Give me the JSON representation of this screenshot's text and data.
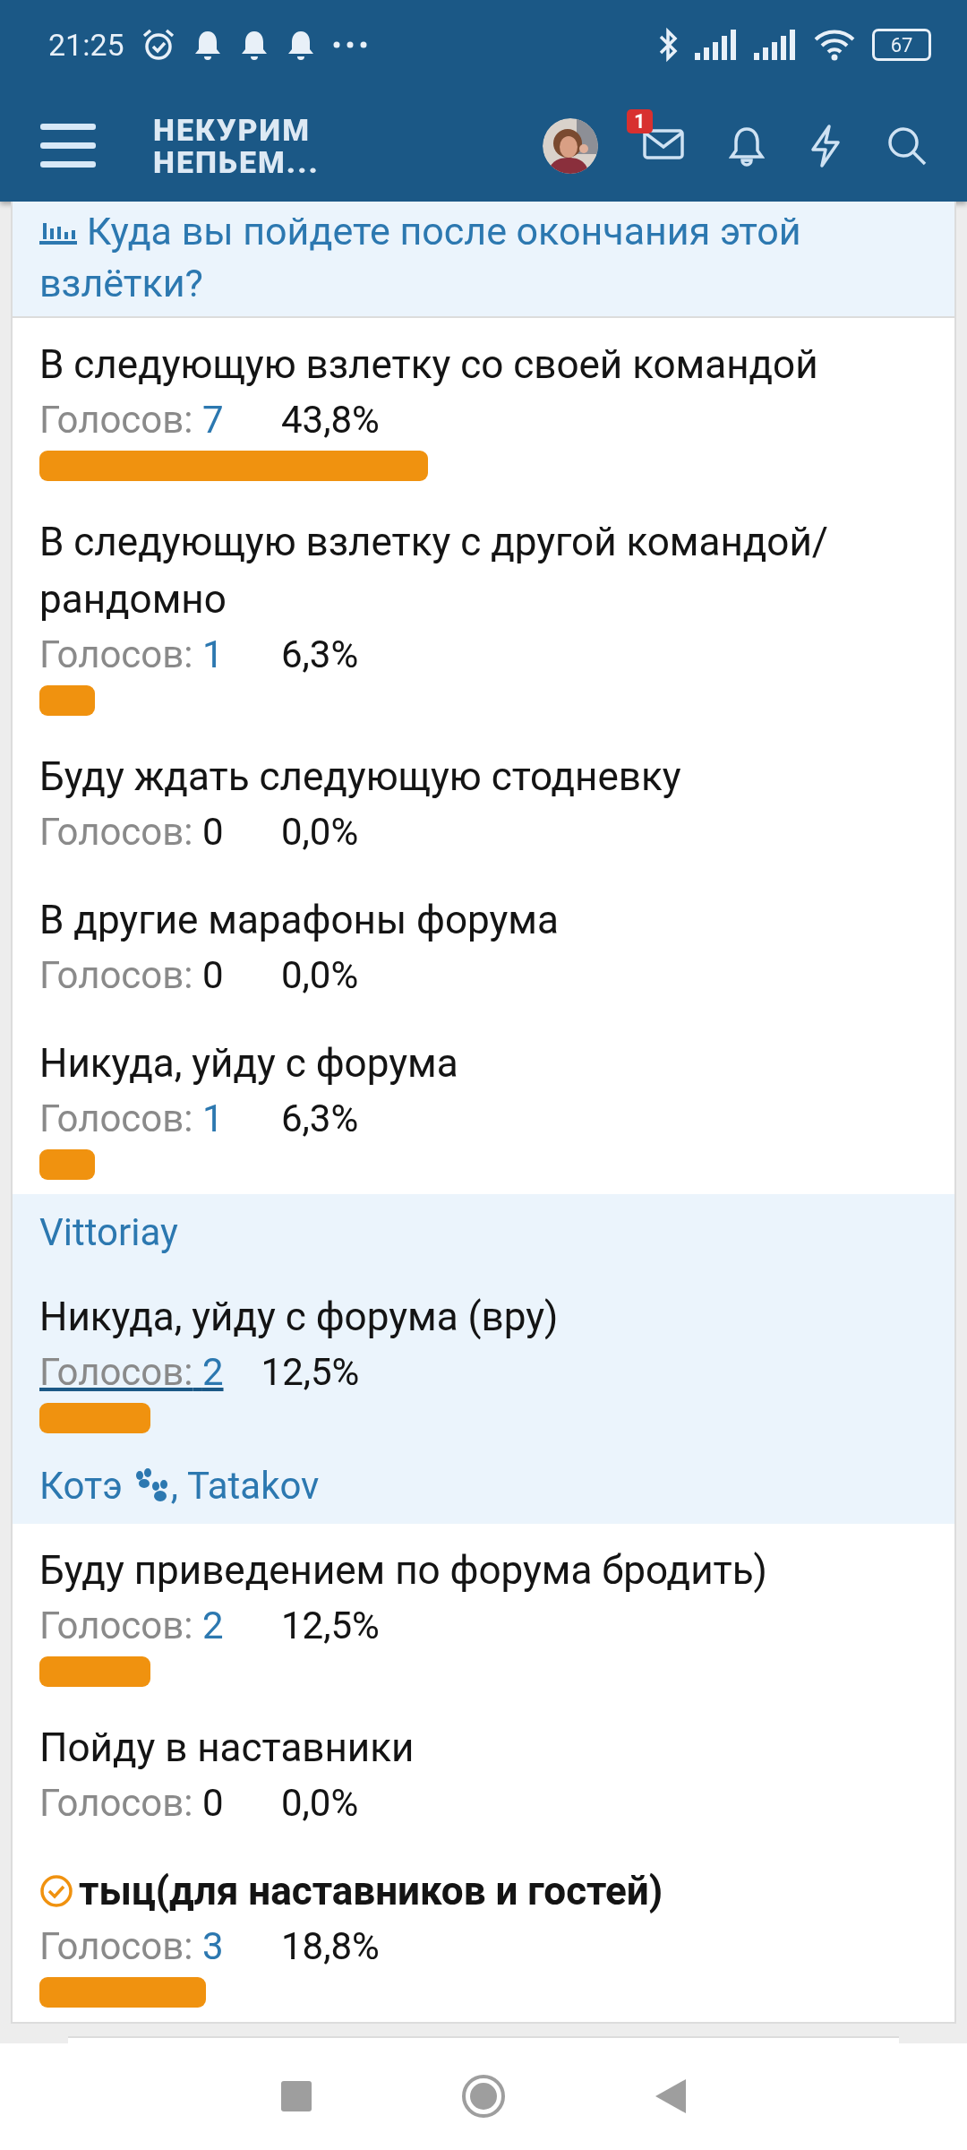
{
  "status_bar": {
    "time": "21:25",
    "battery": "67"
  },
  "header": {
    "logo_line1": "НЕКУРИМ",
    "logo_line2": "НЕПЬЕМ...",
    "mail_badge": "1"
  },
  "poll": {
    "question": "Куда вы пойдете после окончания этой взлётки?",
    "options": [
      {
        "text": "В следующую взлетку со своей командой",
        "votes_label": "Голосов:",
        "count": "7",
        "linked": true,
        "percent": "43,8%",
        "chosen": false,
        "highlighted": false
      },
      {
        "text": "В следующую взлетку с другой командой/ рандомно",
        "votes_label": "Голосов:",
        "count": "1",
        "linked": true,
        "percent": "6,3%",
        "chosen": false,
        "highlighted": false
      },
      {
        "text": "Буду ждать следующую стодневку",
        "votes_label": "Голосов:",
        "count": "0",
        "linked": false,
        "percent": "0,0%",
        "chosen": false,
        "highlighted": false
      },
      {
        "text": "В другие марафоны форума",
        "votes_label": "Голосов:",
        "count": "0",
        "linked": false,
        "percent": "0,0%",
        "chosen": false,
        "highlighted": false
      },
      {
        "text": "Никуда, уйду с форума",
        "votes_label": "Голосов:",
        "count": "1",
        "linked": true,
        "percent": "6,3%",
        "chosen": false,
        "highlighted": false,
        "voters": [
          {
            "name": "Vittoriay",
            "paw": false
          }
        ]
      },
      {
        "text": "Никуда, уйду с форума (вру)",
        "votes_label": "Голосов:",
        "count": "2",
        "linked": true,
        "percent": "12,5%",
        "chosen": false,
        "highlighted": true,
        "voters": [
          {
            "name": "Котэ",
            "paw": true,
            "after": ","
          },
          {
            "name": "Tatakov",
            "paw": false
          }
        ]
      },
      {
        "text": "Буду приведением по форума бродить)",
        "votes_label": "Голосов:",
        "count": "2",
        "linked": true,
        "percent": "12,5%",
        "chosen": false,
        "highlighted": false
      },
      {
        "text": "Пойду в наставники",
        "votes_label": "Голосов:",
        "count": "0",
        "linked": false,
        "percent": "0,0%",
        "chosen": false,
        "highlighted": false
      },
      {
        "text": "тыц(для наставников и гостей)",
        "votes_label": "Голосов:",
        "count": "3",
        "linked": true,
        "percent": "18,8%",
        "chosen": true,
        "highlighted": false
      }
    ]
  }
}
